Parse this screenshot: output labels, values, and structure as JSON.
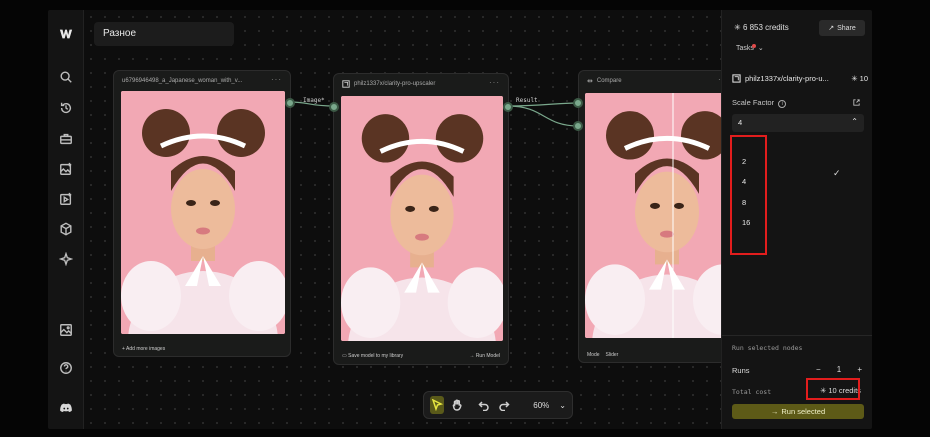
{
  "board": {
    "title": "Разное"
  },
  "nodes": {
    "input": {
      "title": "u6796946498_a_Japanese_woman_with_v...",
      "menu": "···",
      "footer": "+ Add more images"
    },
    "upscaler": {
      "title": "philz1337x/clarity-pro-upscaler",
      "menu": "···",
      "save_label": "Save model to my library",
      "run_label": "Run Model"
    },
    "compare": {
      "title": "Compare",
      "menu": "···",
      "mode_label": "Mode",
      "mode_value": "Slider"
    }
  },
  "edges": {
    "image_label": "Image*",
    "result_label": "Result"
  },
  "toolbar": {
    "zoom": "60%"
  },
  "panel": {
    "credits": "6 853 credits",
    "share": "Share",
    "tasks": "Tasks",
    "model_name": "philz1337x/clarity-pro-u...",
    "model_cost": "10",
    "scale_factor_label": "Scale Factor",
    "scale_factor_value": "4",
    "scale_options": [
      "2",
      "4",
      "8",
      "16"
    ],
    "run_selected_nodes": "Run selected nodes",
    "runs_label": "Runs",
    "runs_minus": "−",
    "runs_value": "1",
    "runs_plus": "+",
    "total_cost_label": "Total cost",
    "total_cost_value": "10 credits",
    "run_button": "Run selected"
  },
  "colors": {
    "accent": "#5d5a17",
    "port": "#7aa88c",
    "highlight": "#e21d1d",
    "photo_bg": "#f1a9b5"
  }
}
